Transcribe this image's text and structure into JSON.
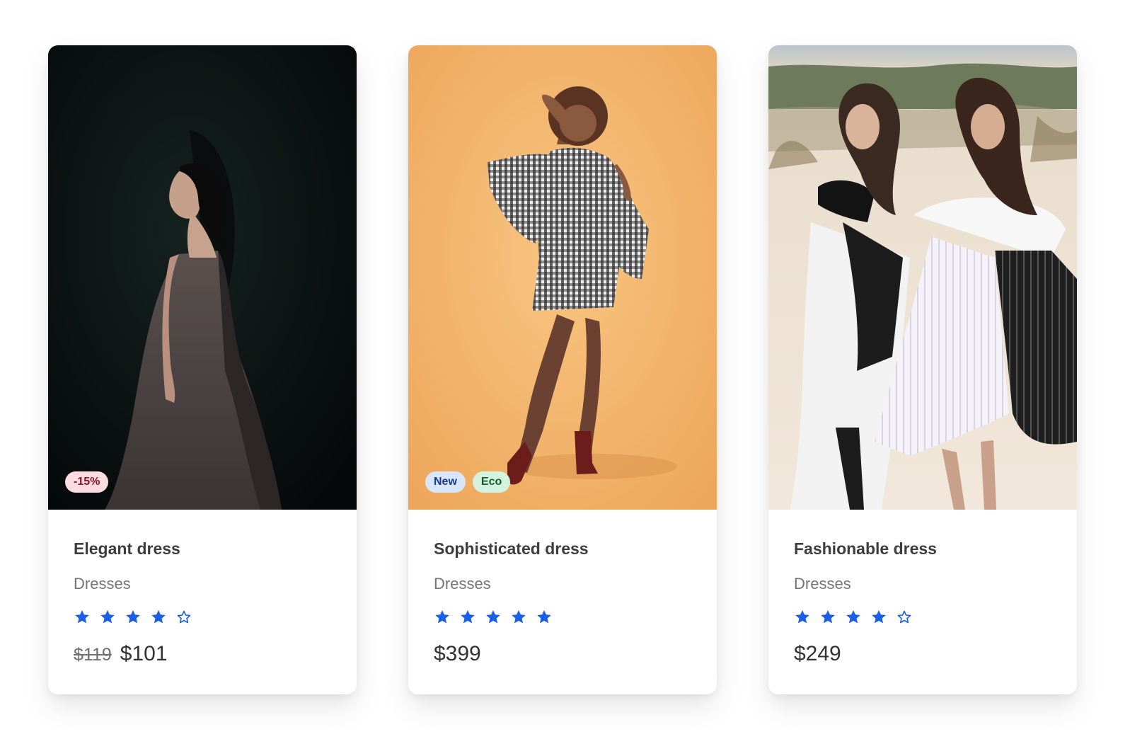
{
  "colors": {
    "star": "#1a5fe6",
    "discount_bg": "#fbdde1",
    "discount_text": "#8a1328",
    "new_bg": "#d9e5fb",
    "new_text": "#173b8c",
    "eco_bg": "#d3f3de",
    "eco_text": "#155c2e"
  },
  "products": [
    {
      "title": "Elegant dress",
      "category": "Dresses",
      "rating": 4,
      "max_rating": 5,
      "price_old": "$119",
      "price": "$101",
      "badges": [
        {
          "label": "-15%",
          "kind": "discount"
        }
      ],
      "image_icon": "photo-woman-dark-gown"
    },
    {
      "title": "Sophisticated dress",
      "category": "Dresses",
      "rating": 5,
      "max_rating": 5,
      "price_old": "",
      "price": "$399",
      "badges": [
        {
          "label": "New",
          "kind": "new"
        },
        {
          "label": "Eco",
          "kind": "eco"
        }
      ],
      "image_icon": "photo-woman-gingham-dress"
    },
    {
      "title": "Fashionable dress",
      "category": "Dresses",
      "rating": 4,
      "max_rating": 5,
      "price_old": "",
      "price": "$249",
      "badges": [],
      "image_icon": "photo-two-women-beach"
    }
  ]
}
